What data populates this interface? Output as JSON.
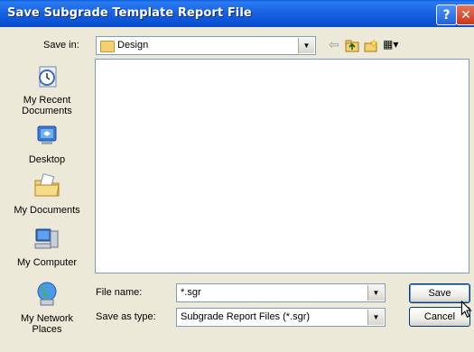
{
  "window": {
    "title": "Save Subgrade Template Report File",
    "help_glyph": "?",
    "close_glyph": "✕"
  },
  "toolbar": {
    "save_in_label": "Save in:",
    "save_in_value": "Design",
    "back_glyph": "⇦",
    "up_glyph": "▲",
    "views_glyph": "▦▾"
  },
  "places": [
    {
      "label": "My Recent Documents",
      "icon": "recent-documents-icon"
    },
    {
      "label": "Desktop",
      "icon": "desktop-icon"
    },
    {
      "label": "My Documents",
      "icon": "my-documents-icon"
    },
    {
      "label": "My Computer",
      "icon": "my-computer-icon"
    },
    {
      "label": "My Network Places",
      "icon": "network-places-icon"
    }
  ],
  "form": {
    "file_name_label": "File name:",
    "file_name_value": "*.sgr",
    "save_as_type_label": "Save as type:",
    "save_as_type_value": "Subgrade Report Files (*.sgr)"
  },
  "buttons": {
    "save": "Save",
    "cancel": "Cancel"
  },
  "colors": {
    "titlebar": "#0b51d4",
    "dialog_bg": "#ece9d8",
    "field_border": "#7f9db9"
  }
}
